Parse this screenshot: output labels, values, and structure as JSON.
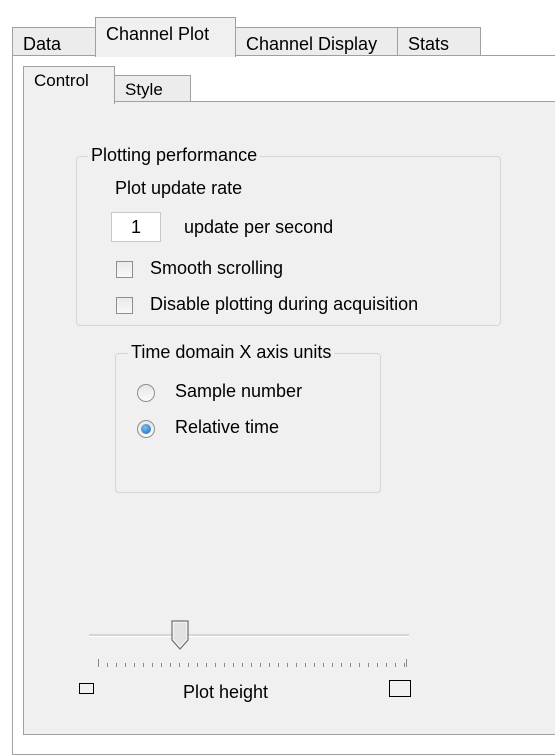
{
  "tabs": {
    "data": "Data",
    "channel_plot": "Channel Plot",
    "channel_display": "Channel Display",
    "stats": "Stats"
  },
  "subtabs": {
    "control": "Control",
    "style": "Style"
  },
  "plotting_performance": {
    "title": "Plotting performance",
    "rate_label": "Plot update rate",
    "rate_value": "1",
    "rate_unit": "update per second",
    "smooth_scrolling": {
      "label": "Smooth scrolling",
      "checked": false
    },
    "disable_plotting": {
      "label": "Disable plotting during acquisition",
      "checked": false
    }
  },
  "time_domain": {
    "title": "Time domain X axis units",
    "options": [
      {
        "label": "Sample number",
        "selected": false
      },
      {
        "label": "Relative time",
        "selected": true
      }
    ]
  },
  "plot_height": {
    "label": "Plot height",
    "level": 0.25
  }
}
